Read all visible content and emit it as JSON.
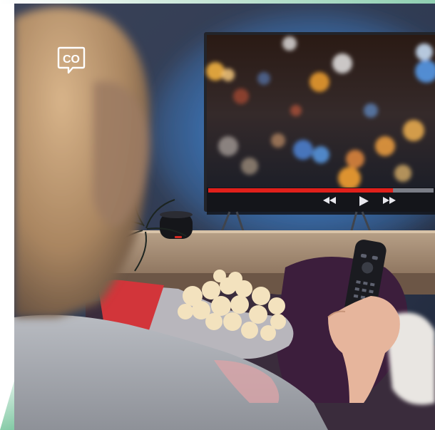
{
  "logo": {
    "text": "CO",
    "icon": "speech-bubble-logo"
  },
  "player": {
    "progress_fraction": 0.82
  },
  "colors": {
    "accent_green": "#7fc8a2",
    "progress_red": "#e0201b",
    "tv_glow": "#4aa8ff"
  }
}
